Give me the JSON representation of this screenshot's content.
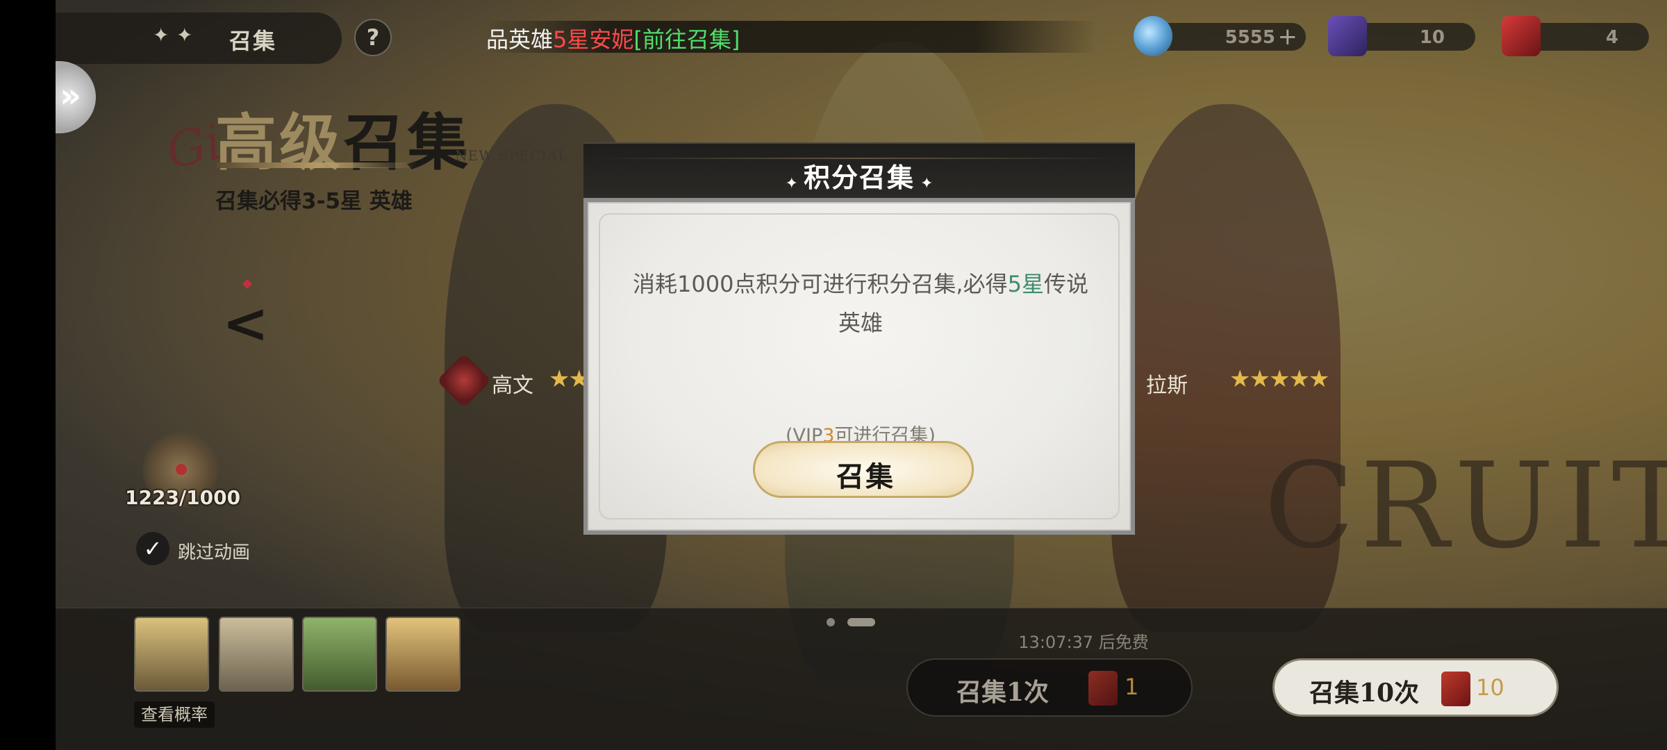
{
  "header": {
    "title": "召集",
    "help_label": "?",
    "side_toggle_label": "»"
  },
  "marquee": {
    "part1": "品英雄",
    "part2": "5星安妮",
    "part3": "[前往召集]"
  },
  "resources": {
    "gems": "5555",
    "gems_add": "+",
    "books": "10",
    "tickets": "4"
  },
  "banner": {
    "title_part1": "高级",
    "title_part2": "召集",
    "tag": "NEW SPECIAL",
    "subtitle": "召集必得3-5星 英雄",
    "script_text": "Gi",
    "prev_arrow": "<"
  },
  "points": {
    "counter": "1223/1000"
  },
  "skip_animation": {
    "check": "✓",
    "label": "跳过动画"
  },
  "heroes": {
    "left_name": "高文",
    "left_stars": "★★",
    "right_name": "拉斯",
    "right_stars": "★★★★★"
  },
  "background_text": "CRUIT",
  "bottom": {
    "view_rates_label": "查看概率",
    "free_timer": "13:07:37 后免费",
    "recruit_1_label": "召集1次",
    "recruit_1_cost": "1",
    "recruit_10_label": "召集10次",
    "recruit_10_cost": "10"
  },
  "modal": {
    "title": "积分召集",
    "spark": "✦",
    "desc_part1": "消耗1000点积分可进行积分召集,必得",
    "desc_highlight": "5星",
    "desc_part2": "传说英雄",
    "vip_prefix": "(VIP",
    "vip_level": "3",
    "vip_suffix": "可进行召集)",
    "recruit_label": "召集"
  },
  "colors": {
    "accent_gold": "#c7a868",
    "highlight_green": "#3c8c6a",
    "marquee_red": "#ff4a4a",
    "marquee_green": "#4fe06a",
    "vip_orange": "#d08a2a"
  }
}
